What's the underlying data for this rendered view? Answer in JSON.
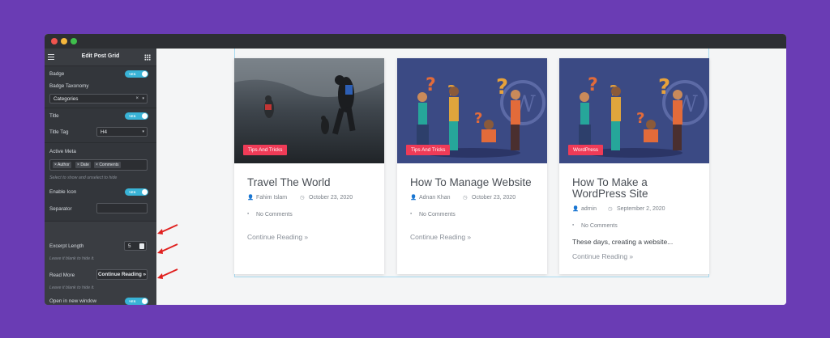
{
  "panel": {
    "title": "Edit Post Grid",
    "badge_label": "Badge",
    "badge_taxonomy_label": "Badge Taxonomy",
    "badge_taxonomy_value": "Categories",
    "title_label": "Title",
    "title_tag_label": "Title Tag",
    "title_tag_value": "H4",
    "active_meta_label": "Active Meta",
    "active_meta_tags": [
      "Author",
      "Date",
      "Comments"
    ],
    "active_meta_hint": "Select to show and unselect to hide",
    "enable_icon_label": "Enable Icon",
    "separator_label": "Separator",
    "separator_value": "",
    "excerpt_length_label": "Excerpt Length",
    "excerpt_length_value": "5",
    "excerpt_hint": "Leave it blank to hide it.",
    "read_more_label": "Read More",
    "read_more_value": "Continue Reading »",
    "read_more_hint": "Leave it blank to hide it.",
    "open_new_window_label": "Open in new window",
    "toggle_text": "YES"
  },
  "cards": [
    {
      "badge": "Tips And Tricks",
      "title_line1": "Travel The World",
      "title_line2": "",
      "author": "Fahim Islam",
      "date": "October 23, 2020",
      "comments": "No Comments",
      "excerpt": "",
      "read_more": "Continue Reading »"
    },
    {
      "badge": "Tips And Tricks",
      "title_line1": "How To Manage Website",
      "title_line2": "",
      "author": "Adnan Khan",
      "date": "October 23, 2020",
      "comments": "No Comments",
      "excerpt": "",
      "read_more": "Continue Reading »"
    },
    {
      "badge": "WordPress",
      "title_line1": "How To Make a",
      "title_line2": "WordPress Site",
      "author": "admin",
      "date": "September 2, 2020",
      "comments": "No Comments",
      "excerpt": "These days, creating a website...",
      "read_more": "Continue Reading »"
    }
  ],
  "colors": {
    "background": "#6a3cb4",
    "panel": "#33363b",
    "toggle": "#39b3d6",
    "badge": "#ef3b57",
    "annotation_arrow": "#e0201f"
  },
  "icons": {
    "author": "user-icon",
    "date": "clock-icon",
    "comments": "comment-icon"
  }
}
